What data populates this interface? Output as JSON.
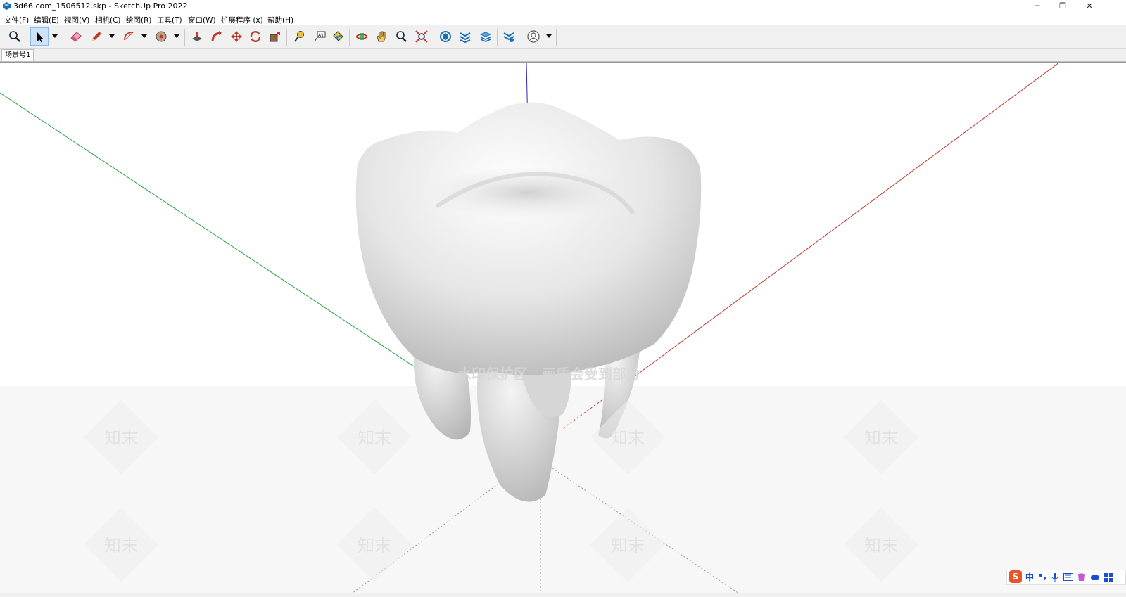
{
  "window": {
    "title": "3d66.com_1506512.skp - SketchUp Pro 2022",
    "controls": {
      "minimize": "─",
      "restore": "❐",
      "close": "✕"
    }
  },
  "menu": {
    "items": [
      "文件(F)",
      "编辑(E)",
      "视图(V)",
      "相机(C)",
      "绘图(R)",
      "工具(T)",
      "窗口(W)",
      "扩展程序 (x)",
      "帮助(H)"
    ]
  },
  "toolbar": {
    "tools": [
      "zoom",
      "select",
      "eraser",
      "pencil",
      "arc",
      "tape",
      "push-pull",
      "follow-me",
      "move",
      "rotate",
      "scale",
      "tape-measure",
      "text",
      "paint-bucket",
      "orbit",
      "pan",
      "zoom",
      "zoom-extents",
      "warehouse",
      "extension-warehouse",
      "layout",
      "send-to-layout",
      "account"
    ]
  },
  "scene_tabs": [
    "场景号1"
  ],
  "viewport": {
    "watermark_text": "水印保护区，画质会受到部分",
    "watermark_logo": "知末",
    "axis_colors": {
      "red": "#c0392b",
      "green": "#2e9e3e",
      "blue": "#2a2aa8"
    }
  },
  "ime": {
    "logo": "S",
    "mode": "中",
    "punct": "•,",
    "icons": [
      "mic-icon",
      "keyboard-icon",
      "skin-icon",
      "game-icon",
      "grid-icon"
    ]
  }
}
